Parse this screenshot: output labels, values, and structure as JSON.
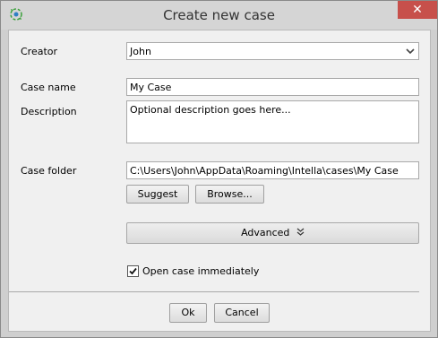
{
  "window": {
    "title": "Create new case",
    "close_glyph": "✕",
    "icon": "intella-app-icon"
  },
  "form": {
    "creator": {
      "label": "Creator",
      "value": "John",
      "icon": "chevron-down-icon"
    },
    "case_name": {
      "label": "Case name",
      "value": "My Case"
    },
    "description": {
      "label": "Description",
      "value": "Optional description goes here..."
    },
    "case_folder": {
      "label": "Case folder",
      "value": "C:\\Users\\John\\AppData\\Roaming\\Intella\\cases\\My Case"
    }
  },
  "buttons": {
    "suggest": "Suggest",
    "browse": "Browse...",
    "advanced": "Advanced",
    "ok": "Ok",
    "cancel": "Cancel"
  },
  "checkbox": {
    "label": "Open case immediately",
    "checked": true
  }
}
